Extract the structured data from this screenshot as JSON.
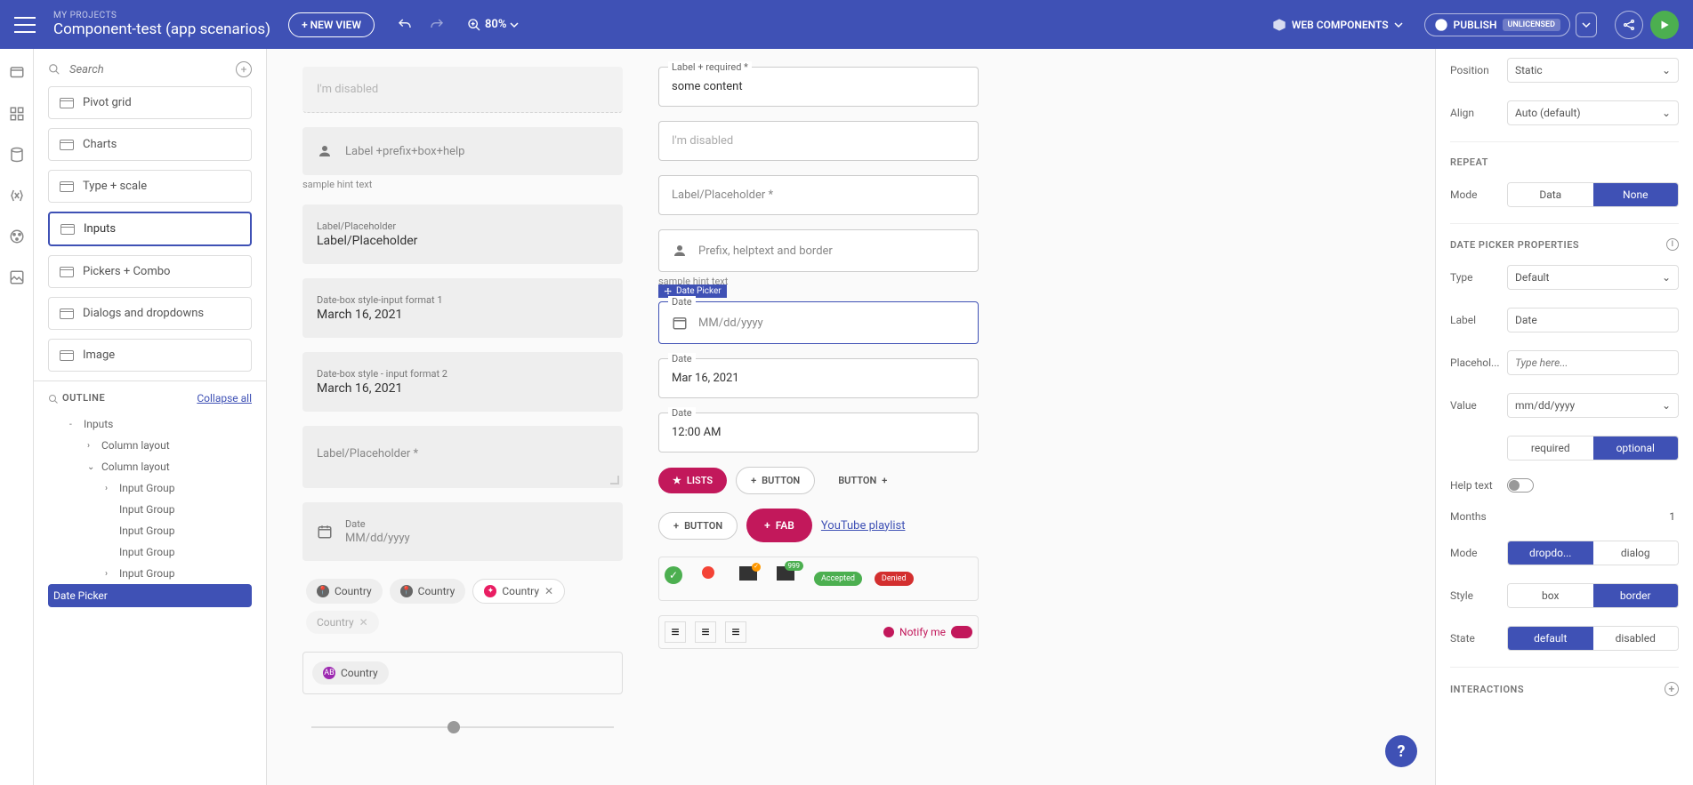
{
  "header": {
    "breadcrumb_label": "MY PROJECTS",
    "title": "Component-test (app scenarios)",
    "new_view": "+ NEW VIEW",
    "zoom": "80%",
    "web_components": "WEB COMPONENTS",
    "publish": "PUBLISH",
    "license_badge": "UNLICENSED"
  },
  "search": {
    "placeholder": "Search"
  },
  "views": [
    {
      "label": "Pivot grid"
    },
    {
      "label": "Charts"
    },
    {
      "label": "Type + scale"
    },
    {
      "label": "Inputs",
      "selected": true
    },
    {
      "label": "Pickers + Combo"
    },
    {
      "label": "Dialogs and dropdowns"
    },
    {
      "label": "Image"
    }
  ],
  "outline": {
    "title": "OUTLINE",
    "collapse": "Collapse all",
    "tree": [
      {
        "label": "Inputs",
        "indent": 1,
        "expanded": true
      },
      {
        "label": "Column layout",
        "indent": 2,
        "chevron": "›"
      },
      {
        "label": "Column layout",
        "indent": 2,
        "chevron": "⌄"
      },
      {
        "label": "Input Group",
        "indent": 3,
        "chevron": "›"
      },
      {
        "label": "Input Group",
        "indent": 3
      },
      {
        "label": "Input Group",
        "indent": 3
      },
      {
        "label": "Input Group",
        "indent": 3
      },
      {
        "label": "Input Group",
        "indent": 3,
        "chevron": "›"
      },
      {
        "label": "Date Picker",
        "indent": 3,
        "selected": true
      }
    ]
  },
  "canvas": {
    "col1": {
      "disabled": "I'm disabled",
      "prefix_label": "Label +prefix+box+help",
      "hint1": "sample hint text",
      "placeholder_label": "Label/Placeholder",
      "placeholder_value": "Label/Placeholder",
      "datebox1_label": "Date-box style-input format 1",
      "datebox1_value": "March 16, 2021",
      "datebox2_label": "Date-box style - input format 2",
      "datebox2_value": "March 16, 2021",
      "textarea_label": "Label/Placeholder *",
      "date3_label": "Date",
      "date3_value": "MM/dd/yyyy",
      "chip_country": "Country"
    },
    "col2": {
      "required_label": "Label + required *",
      "required_value": "some content",
      "disabled": "I'm disabled",
      "placeholder": "Label/Placeholder *",
      "prefix_help": "Prefix, helptext and border",
      "hint": "sample hint text",
      "selection_tag": "Date Picker",
      "date_label": "Date",
      "date_placeholder": "MM/dd/yyyy",
      "date2_label": "Date",
      "date2_value": "Mar 16, 2021",
      "date3_label": "Date",
      "date3_value": "12:00 AM",
      "lists_btn": "LISTS",
      "button_btn": "BUTTON",
      "button2_btn": "BUTTON",
      "add_button_btn": "BUTTON",
      "fab_btn": "FAB",
      "youtube_link": "YouTube playlist",
      "badge_999": "999",
      "accepted": "Accepted",
      "denied": "Denied",
      "notify": "Notify me"
    }
  },
  "props": {
    "position_label": "Position",
    "position_value": "Static",
    "align_label": "Align",
    "align_value": "Auto (default)",
    "repeat_title": "REPEAT",
    "mode_label": "Mode",
    "mode_data": "Data",
    "mode_none": "None",
    "dp_title": "DATE PICKER PROPERTIES",
    "type_label": "Type",
    "type_value": "Default",
    "label_label": "Label",
    "label_value": "Date",
    "placeholder_label": "Placehol...",
    "placeholder_hint": "Type here...",
    "value_label": "Value",
    "value_value": "mm/dd/yyyy",
    "required": "required",
    "optional": "optional",
    "help_label": "Help text",
    "months_label": "Months",
    "months_value": "1",
    "mode2_label": "Mode",
    "mode2_dropdown": "dropdo...",
    "mode2_dialog": "dialog",
    "style_label": "Style",
    "style_box": "box",
    "style_border": "border",
    "state_label": "State",
    "state_default": "default",
    "state_disabled": "disabled",
    "interactions_title": "INTERACTIONS"
  }
}
